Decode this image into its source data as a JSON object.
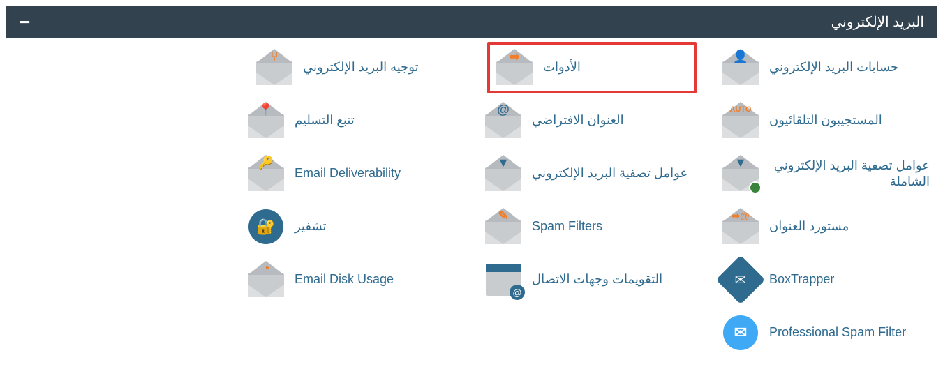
{
  "panel": {
    "title": "البريد الإلكتروني",
    "collapse_glyph": "−"
  },
  "items": {
    "email_accounts": "حسابات البريد الإلكتروني",
    "tools": "الأدوات",
    "forward": "توجيه البريد الإلكتروني",
    "autoresponders": "المستجيبون التلقائيون",
    "default_address": "العنوان الافتراضي",
    "track_delivery": "تتبع التسليم",
    "global_filters": "عوامل تصفية البريد الإلكتروني الشاملة",
    "email_filters": "عوامل تصفية البريد الإلكتروني",
    "deliverability": "Email Deliverability",
    "address_importer": "مستورد العنوان",
    "spam_filters": "Spam Filters",
    "encryption": "تشفير",
    "boxtrapper": "BoxTrapper",
    "calendars": "التقويمات وجهات الاتصال",
    "disk_usage": "Email Disk Usage",
    "pro_spam": "Professional Spam Filter"
  }
}
